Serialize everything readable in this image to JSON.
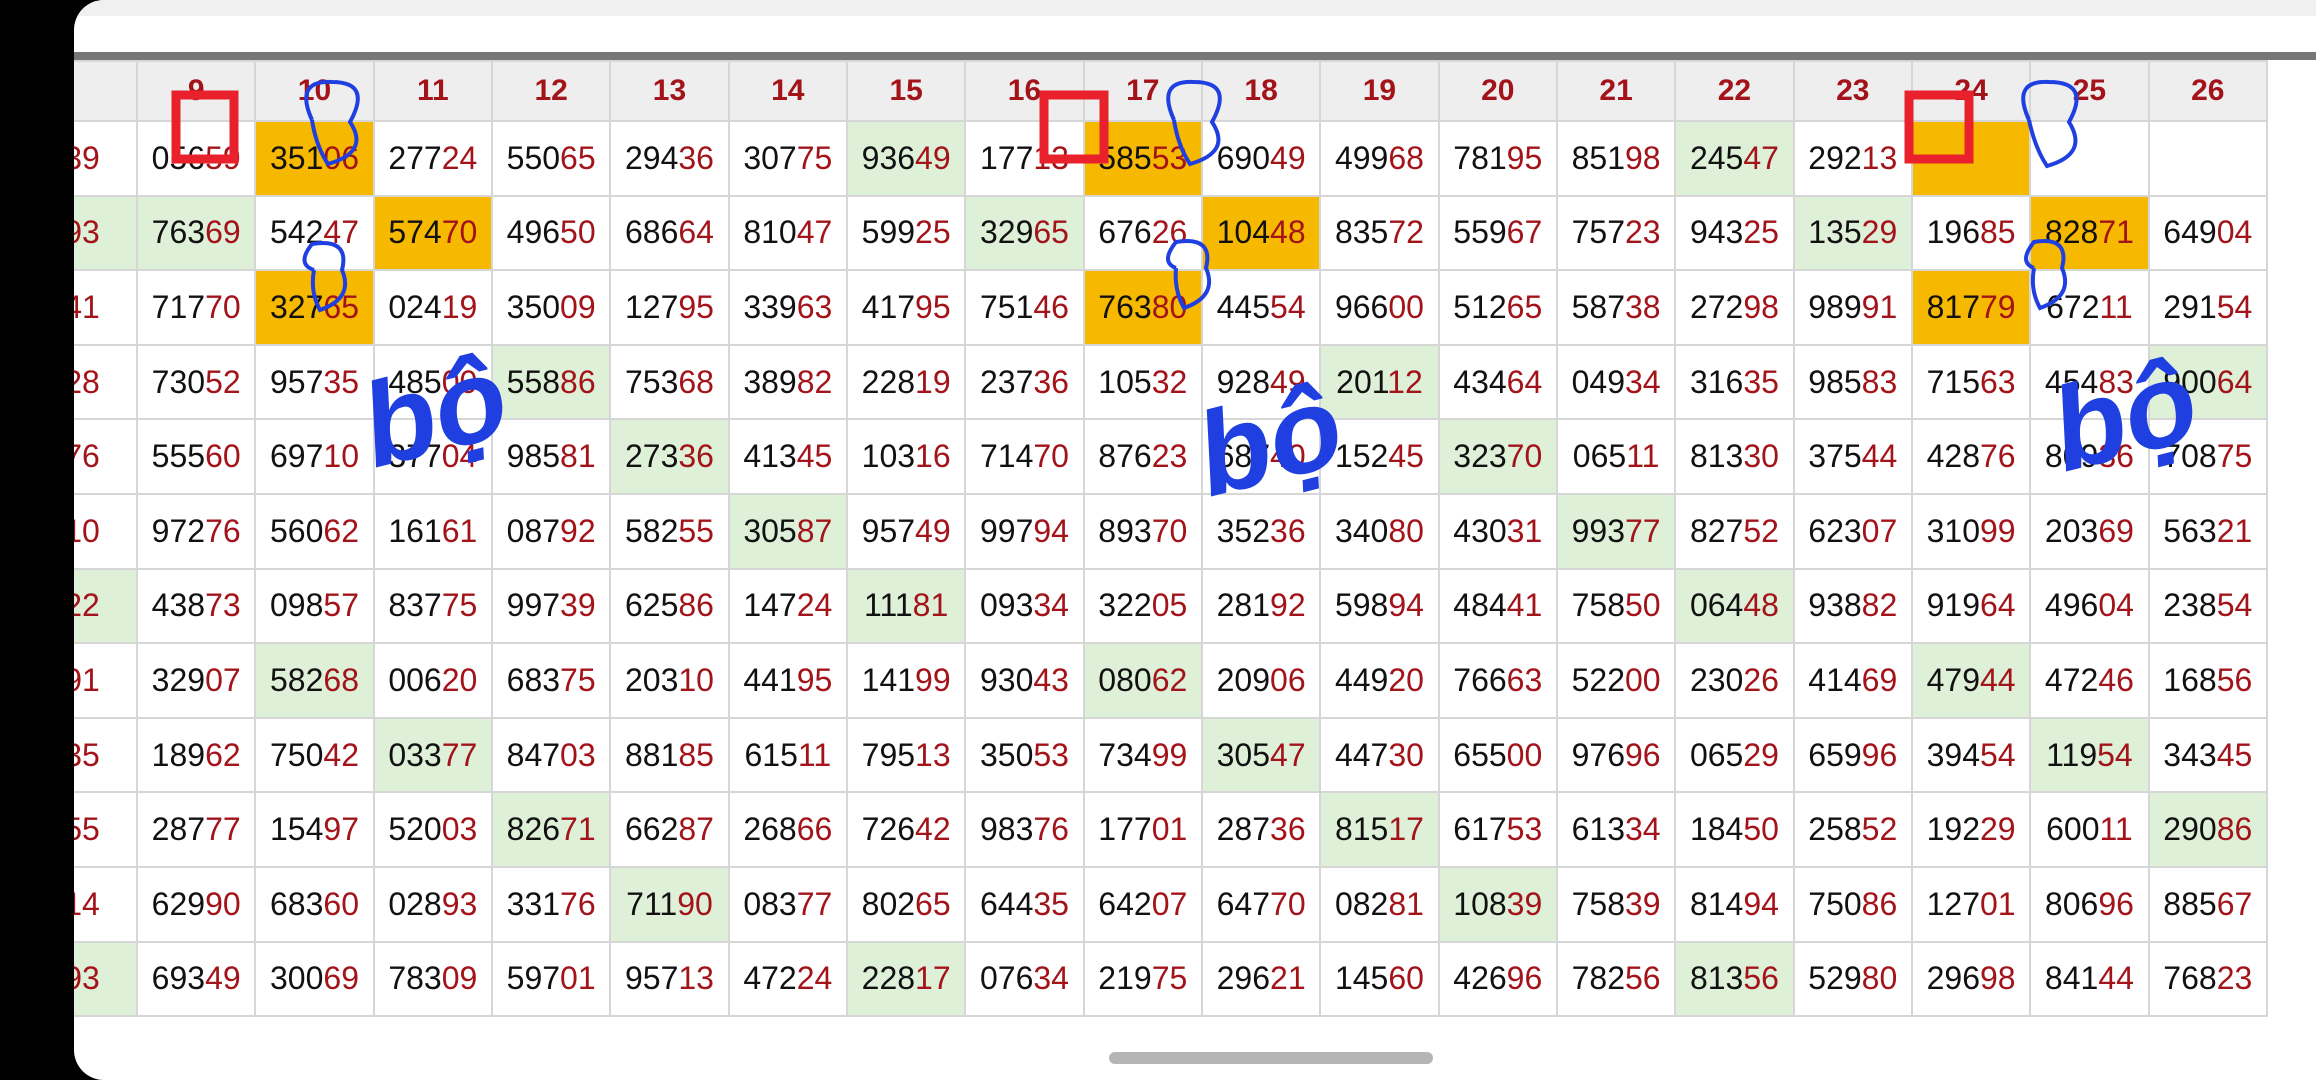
{
  "annotation_text": "bộ",
  "columns": [
    "",
    "9",
    "10",
    "11",
    "12",
    "13",
    "14",
    "15",
    "16",
    "17",
    "18",
    "19",
    "20",
    "21",
    "22",
    "23",
    "24",
    "25",
    "26"
  ],
  "rows": [
    [
      {
        "t": "39",
        "h": "",
        "g": 0
      },
      {
        "t": "05659",
        "h": "05659",
        "g": 0
      },
      {
        "t": "35106",
        "g": 0,
        "y": 1
      },
      {
        "t": "27724",
        "g": 0
      },
      {
        "t": "55065",
        "g": 0
      },
      {
        "t": "29436",
        "g": 0
      },
      {
        "t": "30775",
        "g": 0
      },
      {
        "t": "93649",
        "g": 1
      },
      {
        "t": "17713",
        "g": 0
      },
      {
        "t": "58553",
        "g": 0,
        "y": 1
      },
      {
        "t": "69049",
        "g": 0
      },
      {
        "t": "49968",
        "g": 0
      },
      {
        "t": "78195",
        "g": 0
      },
      {
        "t": "85198",
        "g": 0
      },
      {
        "t": "24547",
        "g": 1
      },
      {
        "t": "29213",
        "g": 0
      },
      {
        "t": "",
        "g": 0,
        "y": 1
      },
      {
        "t": "",
        "g": 0
      },
      {
        "t": "",
        "g": 0
      }
    ],
    [
      {
        "t": "93",
        "g": 1
      },
      {
        "t": "76369",
        "g": 1
      },
      {
        "t": "54247",
        "g": 0
      },
      {
        "t": "57470",
        "g": 0,
        "y": 1
      },
      {
        "t": "49650",
        "g": 0
      },
      {
        "t": "68664",
        "g": 0
      },
      {
        "t": "81047",
        "g": 0
      },
      {
        "t": "59925",
        "g": 0
      },
      {
        "t": "32965",
        "g": 1
      },
      {
        "t": "67626",
        "g": 0
      },
      {
        "t": "10448",
        "g": 0,
        "y": 1
      },
      {
        "t": "83572",
        "g": 0
      },
      {
        "t": "55967",
        "g": 0
      },
      {
        "t": "75723",
        "g": 0
      },
      {
        "t": "94325",
        "g": 0
      },
      {
        "t": "13529",
        "g": 1
      },
      {
        "t": "19685",
        "g": 0
      },
      {
        "t": "82871",
        "g": 0,
        "y": 1
      },
      {
        "t": "64904",
        "g": 0
      }
    ],
    [
      {
        "t": "41",
        "g": 0
      },
      {
        "t": "71770",
        "g": 0
      },
      {
        "t": "32765",
        "g": 0,
        "y": 1
      },
      {
        "t": "02419",
        "g": 0
      },
      {
        "t": "35009",
        "g": 0
      },
      {
        "t": "12795",
        "g": 0
      },
      {
        "t": "33963",
        "g": 0
      },
      {
        "t": "41795",
        "g": 0
      },
      {
        "t": "75146",
        "g": 0
      },
      {
        "t": "76380",
        "g": 0,
        "y": 1
      },
      {
        "t": "44554",
        "g": 0
      },
      {
        "t": "96600",
        "g": 0
      },
      {
        "t": "51265",
        "g": 0
      },
      {
        "t": "58738",
        "g": 0
      },
      {
        "t": "27298",
        "g": 0
      },
      {
        "t": "98991",
        "g": 0
      },
      {
        "t": "81779",
        "g": 0,
        "y": 1
      },
      {
        "t": "67211",
        "g": 0
      },
      {
        "t": "29154",
        "g": 0
      }
    ],
    [
      {
        "t": "28",
        "g": 0
      },
      {
        "t": "73052",
        "g": 0
      },
      {
        "t": "95735",
        "g": 0
      },
      {
        "t": "48500",
        "g": 0
      },
      {
        "t": "55886",
        "g": 1
      },
      {
        "t": "75368",
        "g": 0
      },
      {
        "t": "38982",
        "g": 0
      },
      {
        "t": "22819",
        "g": 0
      },
      {
        "t": "23736",
        "g": 0
      },
      {
        "t": "10532",
        "g": 0
      },
      {
        "t": "92849",
        "g": 0
      },
      {
        "t": "20112",
        "g": 1
      },
      {
        "t": "43464",
        "g": 0
      },
      {
        "t": "04934",
        "g": 0
      },
      {
        "t": "31635",
        "g": 0
      },
      {
        "t": "98583",
        "g": 0
      },
      {
        "t": "71563",
        "g": 0
      },
      {
        "t": "45483",
        "g": 0
      },
      {
        "t": "90064",
        "g": 1
      }
    ],
    [
      {
        "t": "76",
        "g": 0
      },
      {
        "t": "55560",
        "g": 0
      },
      {
        "t": "69710",
        "g": 0
      },
      {
        "t": "37704",
        "g": 0
      },
      {
        "t": "98581",
        "g": 0
      },
      {
        "t": "27336",
        "g": 1
      },
      {
        "t": "41345",
        "g": 0
      },
      {
        "t": "10316",
        "g": 0
      },
      {
        "t": "71470",
        "g": 0
      },
      {
        "t": "87623",
        "g": 0
      },
      {
        "t": "68740",
        "g": 0
      },
      {
        "t": "15245",
        "g": 0
      },
      {
        "t": "32370",
        "g": 1
      },
      {
        "t": "06511",
        "g": 0
      },
      {
        "t": "81330",
        "g": 0
      },
      {
        "t": "37544",
        "g": 0
      },
      {
        "t": "42876",
        "g": 0
      },
      {
        "t": "80936",
        "g": 0
      },
      {
        "t": "70875",
        "g": 0
      }
    ],
    [
      {
        "t": "10",
        "g": 0
      },
      {
        "t": "97276",
        "g": 0
      },
      {
        "t": "56062",
        "g": 0
      },
      {
        "t": "16161",
        "g": 0
      },
      {
        "t": "08792",
        "g": 0
      },
      {
        "t": "58255",
        "g": 0
      },
      {
        "t": "30587",
        "g": 1
      },
      {
        "t": "95749",
        "g": 0
      },
      {
        "t": "99794",
        "g": 0
      },
      {
        "t": "89370",
        "g": 0
      },
      {
        "t": "35236",
        "g": 0
      },
      {
        "t": "34080",
        "g": 0
      },
      {
        "t": "43031",
        "g": 0
      },
      {
        "t": "99377",
        "g": 1
      },
      {
        "t": "82752",
        "g": 0
      },
      {
        "t": "62307",
        "g": 0
      },
      {
        "t": "31099",
        "g": 0
      },
      {
        "t": "20369",
        "g": 0
      },
      {
        "t": "56321",
        "g": 0
      }
    ],
    [
      {
        "t": "22",
        "g": 1
      },
      {
        "t": "43873",
        "g": 0
      },
      {
        "t": "09857",
        "g": 0
      },
      {
        "t": "83775",
        "g": 0
      },
      {
        "t": "99739",
        "g": 0
      },
      {
        "t": "62586",
        "g": 0
      },
      {
        "t": "14724",
        "g": 0
      },
      {
        "t": "11181",
        "g": 1
      },
      {
        "t": "09334",
        "g": 0
      },
      {
        "t": "32205",
        "g": 0
      },
      {
        "t": "28192",
        "g": 0
      },
      {
        "t": "59894",
        "g": 0
      },
      {
        "t": "48441",
        "g": 0
      },
      {
        "t": "75850",
        "g": 0
      },
      {
        "t": "06448",
        "g": 1
      },
      {
        "t": "93882",
        "g": 0
      },
      {
        "t": "91964",
        "g": 0
      },
      {
        "t": "49604",
        "g": 0
      },
      {
        "t": "23854",
        "g": 0
      }
    ],
    [
      {
        "t": "91",
        "g": 0
      },
      {
        "t": "32907",
        "g": 0
      },
      {
        "t": "58268",
        "g": 1
      },
      {
        "t": "00620",
        "g": 0
      },
      {
        "t": "68375",
        "g": 0
      },
      {
        "t": "20310",
        "g": 0
      },
      {
        "t": "44195",
        "g": 0
      },
      {
        "t": "14199",
        "g": 0
      },
      {
        "t": "93043",
        "g": 0
      },
      {
        "t": "08062",
        "g": 1
      },
      {
        "t": "20906",
        "g": 0
      },
      {
        "t": "44920",
        "g": 0
      },
      {
        "t": "76663",
        "g": 0
      },
      {
        "t": "52200",
        "g": 0
      },
      {
        "t": "23026",
        "g": 0
      },
      {
        "t": "41469",
        "g": 0
      },
      {
        "t": "47944",
        "g": 1
      },
      {
        "t": "47246",
        "g": 0
      },
      {
        "t": "16856",
        "g": 0
      }
    ],
    [
      {
        "t": "35",
        "g": 0
      },
      {
        "t": "18962",
        "g": 0
      },
      {
        "t": "75042",
        "g": 0
      },
      {
        "t": "03377",
        "g": 1
      },
      {
        "t": "84703",
        "g": 0
      },
      {
        "t": "88185",
        "g": 0
      },
      {
        "t": "61511",
        "g": 0
      },
      {
        "t": "79513",
        "g": 0
      },
      {
        "t": "35053",
        "g": 0
      },
      {
        "t": "73499",
        "g": 0
      },
      {
        "t": "30547",
        "g": 1
      },
      {
        "t": "44730",
        "g": 0
      },
      {
        "t": "65500",
        "g": 0
      },
      {
        "t": "97696",
        "g": 0
      },
      {
        "t": "06529",
        "g": 0
      },
      {
        "t": "65996",
        "g": 0
      },
      {
        "t": "39454",
        "g": 0
      },
      {
        "t": "11954",
        "g": 1
      },
      {
        "t": "34345",
        "g": 0
      }
    ],
    [
      {
        "t": "55",
        "g": 0
      },
      {
        "t": "28777",
        "g": 0
      },
      {
        "t": "15497",
        "g": 0
      },
      {
        "t": "52003",
        "g": 0
      },
      {
        "t": "82671",
        "g": 1
      },
      {
        "t": "66287",
        "g": 0
      },
      {
        "t": "26866",
        "g": 0
      },
      {
        "t": "72642",
        "g": 0
      },
      {
        "t": "98376",
        "g": 0
      },
      {
        "t": "17701",
        "g": 0
      },
      {
        "t": "28736",
        "g": 0
      },
      {
        "t": "81517",
        "g": 1
      },
      {
        "t": "61753",
        "g": 0
      },
      {
        "t": "61334",
        "g": 0
      },
      {
        "t": "18450",
        "g": 0
      },
      {
        "t": "25852",
        "g": 0
      },
      {
        "t": "19229",
        "g": 0
      },
      {
        "t": "60011",
        "g": 0
      },
      {
        "t": "29086",
        "g": 1
      }
    ],
    [
      {
        "t": "14",
        "g": 0
      },
      {
        "t": "62990",
        "g": 0
      },
      {
        "t": "68360",
        "g": 0
      },
      {
        "t": "02893",
        "g": 0
      },
      {
        "t": "33176",
        "g": 0
      },
      {
        "t": "71190",
        "g": 1
      },
      {
        "t": "08377",
        "g": 0
      },
      {
        "t": "80265",
        "g": 0
      },
      {
        "t": "64435",
        "g": 0
      },
      {
        "t": "64207",
        "g": 0
      },
      {
        "t": "64770",
        "g": 0
      },
      {
        "t": "08281",
        "g": 0
      },
      {
        "t": "10839",
        "g": 1
      },
      {
        "t": "75839",
        "g": 0
      },
      {
        "t": "81494",
        "g": 0
      },
      {
        "t": "75086",
        "g": 0
      },
      {
        "t": "12701",
        "g": 0
      },
      {
        "t": "80696",
        "g": 0
      },
      {
        "t": "88567",
        "g": 0
      }
    ],
    [
      {
        "t": "93",
        "g": 1
      },
      {
        "t": "69349",
        "g": 0
      },
      {
        "t": "30069",
        "g": 0
      },
      {
        "t": "78309",
        "g": 0
      },
      {
        "t": "59701",
        "g": 0
      },
      {
        "t": "95713",
        "g": 0
      },
      {
        "t": "47224",
        "g": 0
      },
      {
        "t": "22817",
        "g": 1
      },
      {
        "t": "07634",
        "g": 0
      },
      {
        "t": "21975",
        "g": 0
      },
      {
        "t": "29621",
        "g": 0
      },
      {
        "t": "14560",
        "g": 0
      },
      {
        "t": "42696",
        "g": 0
      },
      {
        "t": "78256",
        "g": 0
      },
      {
        "t": "81356",
        "g": 1
      },
      {
        "t": "52980",
        "g": 0
      },
      {
        "t": "29698",
        "g": 0
      },
      {
        "t": "84144",
        "g": 0
      },
      {
        "t": "76823",
        "g": 0
      }
    ]
  ]
}
